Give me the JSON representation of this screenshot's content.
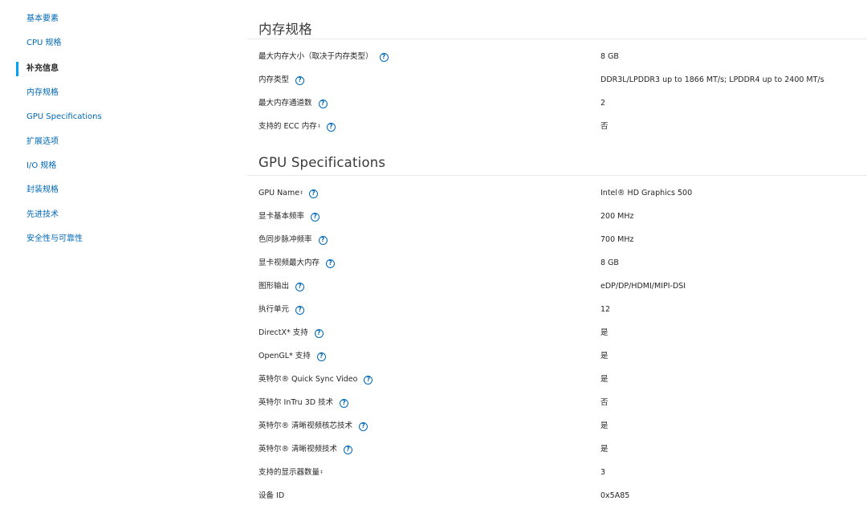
{
  "sidebar": {
    "items": [
      {
        "label": "基本要素"
      },
      {
        "label": "CPU 规格"
      },
      {
        "label": "补充信息"
      },
      {
        "label": "内存规格"
      },
      {
        "label": "GPU Specifications"
      },
      {
        "label": "扩展选项"
      },
      {
        "label": "I/O 规格"
      },
      {
        "label": "封装规格"
      },
      {
        "label": "先进技术"
      },
      {
        "label": "安全性与可靠性"
      }
    ],
    "active_index": 2
  },
  "memory": {
    "title": "内存规格",
    "rows": [
      {
        "label": "最大内存大小（取决于内存类型）",
        "sup": "",
        "value": "8 GB"
      },
      {
        "label": "内存类型",
        "sup": "",
        "value": "DDR3L/LPDDR3 up to 1866 MT/s; LPDDR4 up to 2400 MT/s"
      },
      {
        "label": "最大内存通道数",
        "sup": "",
        "value": "2"
      },
      {
        "label": "支持的 ECC 内存",
        "sup": "‡",
        "value": "否"
      }
    ]
  },
  "gpu": {
    "title": "GPU Specifications",
    "rows": [
      {
        "label": "GPU Name",
        "sup": "‡",
        "value": "Intel® HD Graphics 500"
      },
      {
        "label": "显卡基本频率",
        "sup": "",
        "value": "200 MHz"
      },
      {
        "label": "色同步脉冲频率",
        "sup": "",
        "value": "700 MHz"
      },
      {
        "label": "显卡视频最大内存",
        "sup": "",
        "value": "8 GB"
      },
      {
        "label": "图形输出",
        "sup": "",
        "value": "eDP/DP/HDMI/MIPI-DSI"
      },
      {
        "label": "执行单元",
        "sup": "",
        "value": "12"
      },
      {
        "label": "DirectX* 支持",
        "sup": "",
        "value": "是"
      },
      {
        "label": "OpenGL* 支持",
        "sup": "",
        "value": "是"
      },
      {
        "label": "英特尔® Quick Sync Video",
        "sup": "",
        "value": "是"
      },
      {
        "label": "英特尔 InTru 3D 技术",
        "sup": "",
        "value": "否"
      },
      {
        "label": "英特尔® 清晰视频核芯技术",
        "sup": "",
        "value": "是"
      },
      {
        "label": "英特尔® 清晰视频技术",
        "sup": "",
        "value": "是"
      },
      {
        "label": "支持的显示器数量",
        "sup": "‡",
        "value": "3"
      },
      {
        "label": "设备 ID",
        "sup": "",
        "value": "0x5A85"
      }
    ]
  },
  "icons": {
    "help": "help-circle-icon",
    "help_glyph": "?"
  },
  "colors": {
    "link": "#0068b5",
    "active_marker": "#00a3f6",
    "text": "#262626"
  }
}
